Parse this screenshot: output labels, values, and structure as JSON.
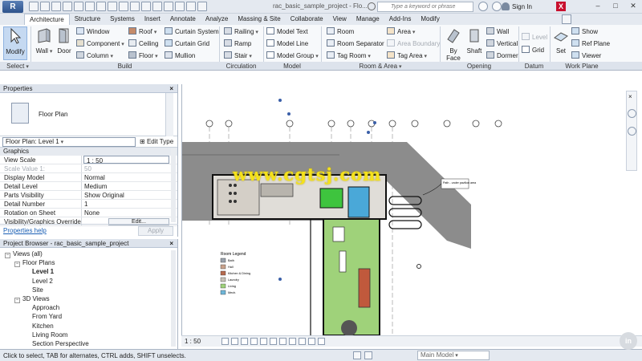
{
  "titlebar": {
    "app_letter": "R",
    "doc_title": "rac_basic_sample_project - Flo...",
    "search_placeholder": "Type a keyword or phrase",
    "signin": "Sign In",
    "minimize": "–",
    "maximize": "□",
    "close": "✕"
  },
  "tabs": [
    "Architecture",
    "Structure",
    "Systems",
    "Insert",
    "Annotate",
    "Analyze",
    "Massing & Site",
    "Collaborate",
    "View",
    "Manage",
    "Add-Ins",
    "Modify"
  ],
  "ribbon": {
    "modify": "Modify",
    "select": "Select",
    "build": {
      "label": "Build",
      "wall": "Wall",
      "door": "Door",
      "window": "Window",
      "component": "Component",
      "column": "Column",
      "roof": "Roof",
      "ceiling": "Ceiling",
      "floor": "Floor",
      "curtain_system": "Curtain System",
      "curtain_grid": "Curtain Grid",
      "mullion": "Mullion"
    },
    "circulation": {
      "label": "Circulation",
      "railing": "Railing",
      "ramp": "Ramp",
      "stair": "Stair"
    },
    "model": {
      "label": "Model",
      "model_text": "Model Text",
      "model_line": "Model Line",
      "model_group": "Model Group"
    },
    "room_area": {
      "label": "Room & Area",
      "room": "Room",
      "room_separator": "Room Separator",
      "tag_room": "Tag Room",
      "area": "Area",
      "area_boundary": "Area Boundary",
      "tag_area": "Tag Area"
    },
    "opening": {
      "label": "Opening",
      "by_face": "By Face",
      "shaft": "Shaft",
      "wall": "Wall",
      "vertical": "Vertical",
      "dormer": "Dormer"
    },
    "datum": {
      "label": "Datum",
      "level": "Level",
      "grid": "Grid"
    },
    "work_plane": {
      "label": "Work Plane",
      "set": "Set",
      "show": "Show",
      "ref_plane": "Ref Plane",
      "viewer": "Viewer"
    }
  },
  "properties": {
    "title": "Properties",
    "close": "×",
    "type_name": "Floor Plan",
    "instance": "Floor Plan: Level 1",
    "edit_type": "Edit Type",
    "category": "Graphics",
    "rows": [
      {
        "k": "View Scale",
        "v": "1 : 50"
      },
      {
        "k": "Scale Value    1:",
        "v": "50"
      },
      {
        "k": "Display Model",
        "v": "Normal"
      },
      {
        "k": "Detail Level",
        "v": "Medium"
      },
      {
        "k": "Parts Visibility",
        "v": "Show Original"
      },
      {
        "k": "Detail Number",
        "v": "1"
      },
      {
        "k": "Rotation on Sheet",
        "v": "None"
      },
      {
        "k": "Visibility/Graphics Overrides",
        "v": "Edit..."
      }
    ],
    "help": "Properties help",
    "apply": "Apply"
  },
  "browser": {
    "title": "Project Browser - rac_basic_sample_project",
    "close": "×",
    "items": [
      {
        "label": "Views (all)",
        "indent": 0,
        "exp": "−",
        "bold": false
      },
      {
        "label": "Floor Plans",
        "indent": 1,
        "exp": "−",
        "bold": false
      },
      {
        "label": "Level 1",
        "indent": 2,
        "exp": "",
        "bold": true
      },
      {
        "label": "Level 2",
        "indent": 2,
        "exp": "",
        "bold": false
      },
      {
        "label": "Site",
        "indent": 2,
        "exp": "",
        "bold": false
      },
      {
        "label": "3D Views",
        "indent": 1,
        "exp": "−",
        "bold": false
      },
      {
        "label": "Approach",
        "indent": 2,
        "exp": "",
        "bold": false
      },
      {
        "label": "From Yard",
        "indent": 2,
        "exp": "",
        "bold": false
      },
      {
        "label": "Kitchen",
        "indent": 2,
        "exp": "",
        "bold": false
      },
      {
        "label": "Living Room",
        "indent": 2,
        "exp": "",
        "bold": false
      },
      {
        "label": "Section Perspective",
        "indent": 2,
        "exp": "",
        "bold": false
      }
    ]
  },
  "canvas": {
    "room_legend_title": "Room Legend",
    "legend": [
      {
        "label": "Bath",
        "color": "#9aa2ad"
      },
      {
        "label": "Hall",
        "color": "#c9a28c"
      },
      {
        "label": "Kitchen & Dining",
        "color": "#b66a4e"
      },
      {
        "label": "Laundry",
        "color": "#c9c3b8"
      },
      {
        "label": "Living",
        "color": "#9fd27a"
      },
      {
        "label": "Mech.",
        "color": "#6fb7d9"
      }
    ],
    "callout": "Path - under pavilion area"
  },
  "viewbar": {
    "scale": "1 : 50"
  },
  "status": {
    "message": "Click to select, TAB for alternates, CTRL adds, SHIFT unselects.",
    "main_model": "Main Model"
  },
  "watermark": "www.cgtsj.com",
  "colors": {
    "accent": "#1a5fb4",
    "lawn": "#9fd27a",
    "paving": "#8c8c8c"
  }
}
